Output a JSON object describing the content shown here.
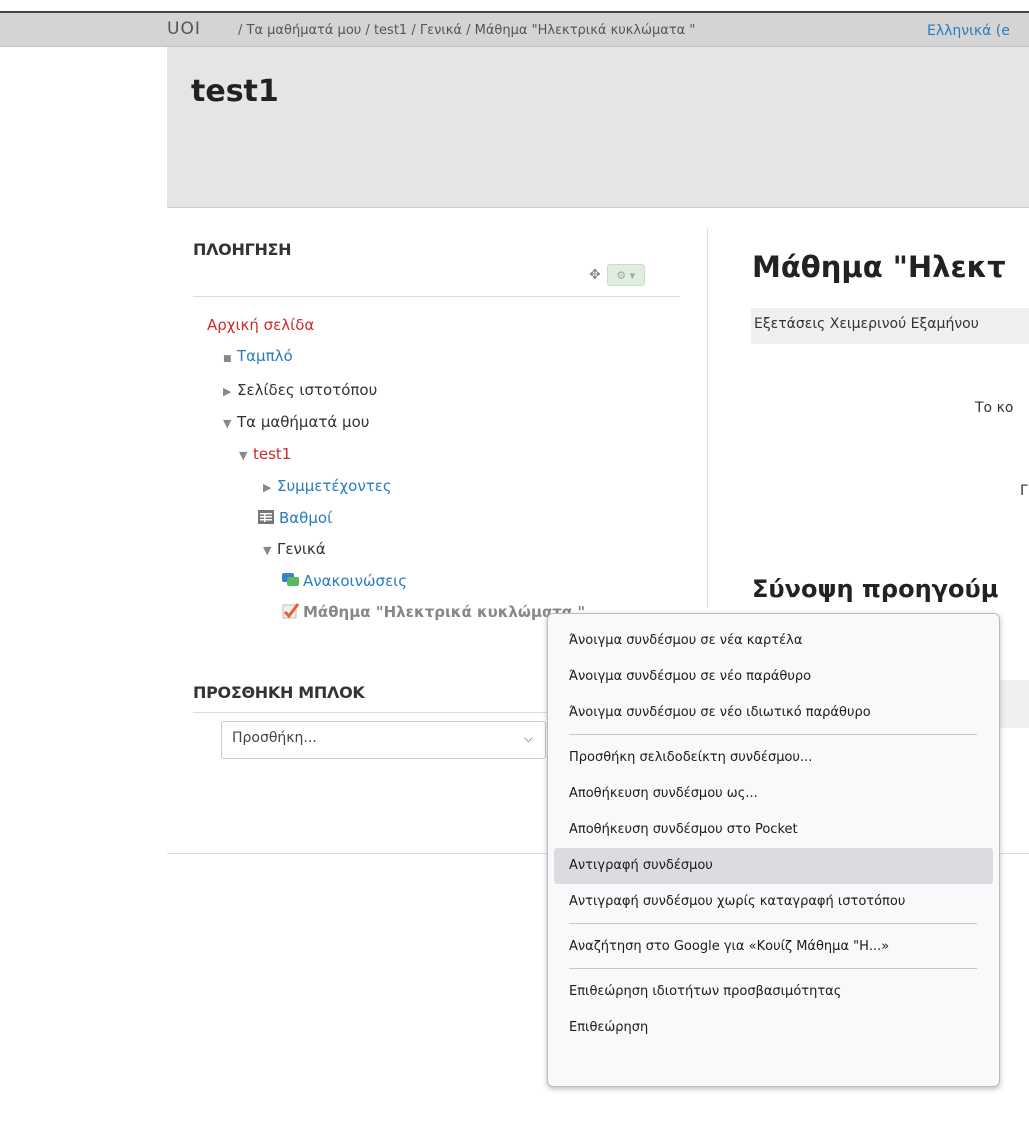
{
  "navbar": {
    "brand": "UOI",
    "breadcrumb": "/ Τα μαθήματά μου / test1 / Γενικά / Μάθημα \"Ηλεκτρικά κυκλώματα \"",
    "language": "Ελληνικά (e"
  },
  "course": {
    "title": "test1"
  },
  "navigation": {
    "title": "ΠΛΟΗΓΗΣΗ",
    "items": [
      {
        "label": "Αρχική σελίδα"
      },
      {
        "label": "Ταμπλό"
      },
      {
        "label": "Σελίδες ιστοτόπου"
      },
      {
        "label": "Τα μαθήματά μου"
      },
      {
        "label": "test1"
      },
      {
        "label": "Συμμετέχοντες"
      },
      {
        "label": "Βαθμοί"
      },
      {
        "label": "Γενικά"
      },
      {
        "label": "Ανακοινώσεις"
      },
      {
        "label": "Μάθημα \"Ηλεκτρικά κυκλώματα \""
      }
    ]
  },
  "add_block": {
    "title": "ΠΡΟΣΘΗΚΗ ΜΠΛΟΚ",
    "select_value": "Προσθήκη..."
  },
  "main": {
    "title": "Μάθημα \"Ηλεκτ",
    "subtitle": "Εξετάσεις Χειμερινού Εξαμήνου",
    "text1": "Το κο",
    "text2": "Γ",
    "summary_title": "Σύνοψη προηγούμ"
  },
  "context_menu": {
    "items": [
      "Άνοιγμα συνδέσμου σε νέα καρτέλα",
      "Άνοιγμα συνδέσμου σε νέο παράθυρο",
      "Άνοιγμα συνδέσμου σε νέο ιδιωτικό παράθυρο",
      "Προσθήκη σελιδοδείκτη συνδέσμου...",
      "Αποθήκευση συνδέσμου ως...",
      "Αποθήκευση συνδέσμου στο Pocket",
      "Αντιγραφή συνδέσμου",
      "Αντιγραφή συνδέσμου χωρίς καταγραφή ιστοτόπου",
      "Αναζήτηση στο Google για «Κουίζ Μάθημα \"Η...»",
      "Επιθεώρηση ιδιοτήτων προσβασιμότητας",
      "Επιθεώρηση"
    ]
  }
}
